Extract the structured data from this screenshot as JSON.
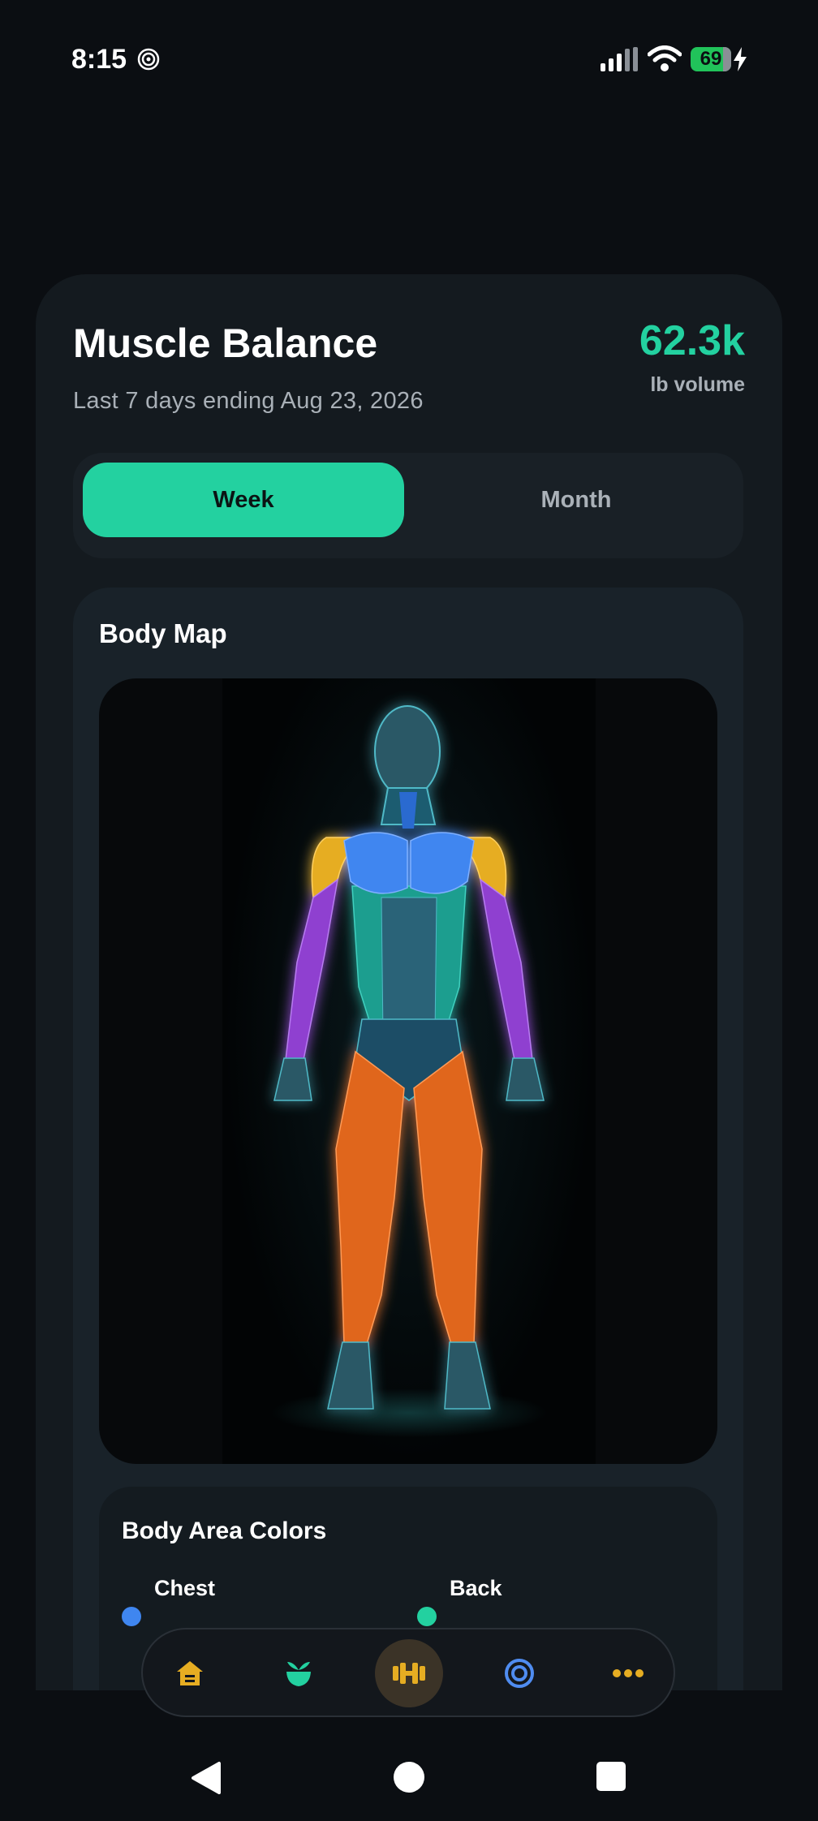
{
  "status_bar": {
    "time": "8:15",
    "battery_level": "69",
    "icons": [
      "focus-icon",
      "signal-icon",
      "wifi-icon",
      "battery-icon",
      "charging-bolt-icon"
    ]
  },
  "header": {
    "title": "Muscle Balance",
    "subtitle": "Last 7 days ending Aug 23, 2026",
    "volume_value": "62.3k",
    "volume_label": "lb volume"
  },
  "period_toggle": {
    "options": [
      {
        "label": "Week",
        "selected": true
      },
      {
        "label": "Month",
        "selected": false
      }
    ]
  },
  "body_map": {
    "title": "Body Map"
  },
  "legend": {
    "title": "Body Area Colors",
    "items": [
      {
        "label": "Chest",
        "sub": "",
        "color": "#3f86f0"
      },
      {
        "label": "Back",
        "sub": "",
        "color": "#23d1a0"
      }
    ]
  },
  "colors": {
    "accent": "#23d1a0",
    "chest": "#3f86f0",
    "shoulders": "#e6ad22",
    "arms": "#8f3fd0",
    "core": "#1f9e8f",
    "legs": "#e0661e"
  },
  "bottom_nav": {
    "tabs": [
      {
        "icon": "home-icon",
        "active": false
      },
      {
        "icon": "nutrition-icon",
        "active": false
      },
      {
        "icon": "dumbbell-icon",
        "active": true
      },
      {
        "icon": "target-icon",
        "active": false
      },
      {
        "icon": "more-icon",
        "active": false
      }
    ]
  },
  "system_nav": [
    "back-icon",
    "home-circle-icon",
    "recents-icon"
  ]
}
